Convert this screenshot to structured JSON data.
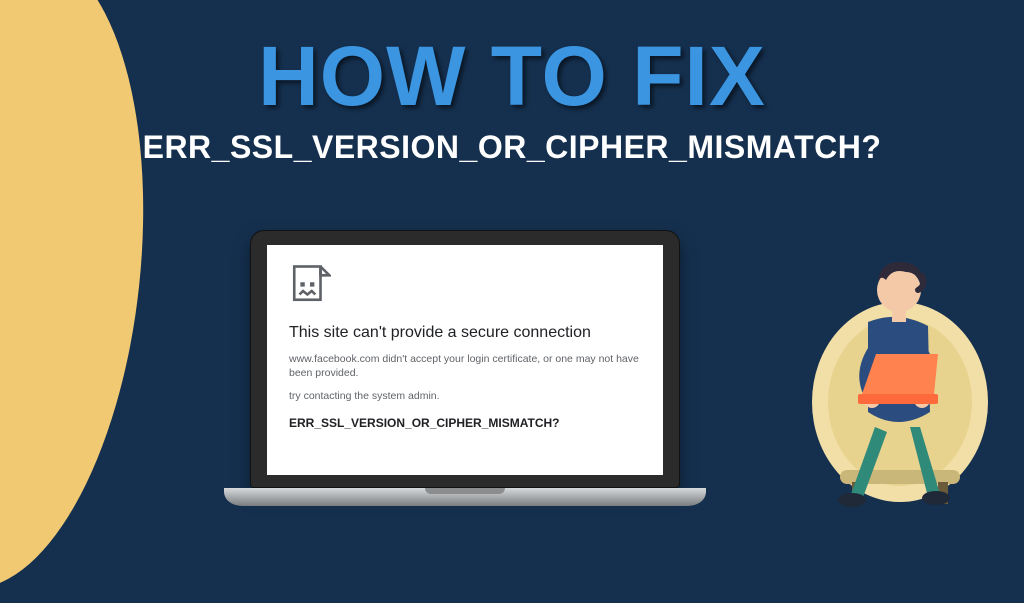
{
  "headline": {
    "main": "HOW TO FIX",
    "sub": "ERR_SSL_VERSION_OR_CIPHER_MISMATCH?"
  },
  "laptop_error": {
    "title": "This site can't provide a secure connection",
    "body": "www.facebook.com didn't accept your login certificate, or one may not have been provided.",
    "try": "try contacting the system admin.",
    "code": "ERR_SSL_VERSION_OR_CIPHER_MISMATCH?"
  },
  "colors": {
    "background": "#15304f",
    "accent_yellow": "#f2c973",
    "headline_blue": "#3b95e0",
    "laptop_orange": "#ff6a3c"
  }
}
